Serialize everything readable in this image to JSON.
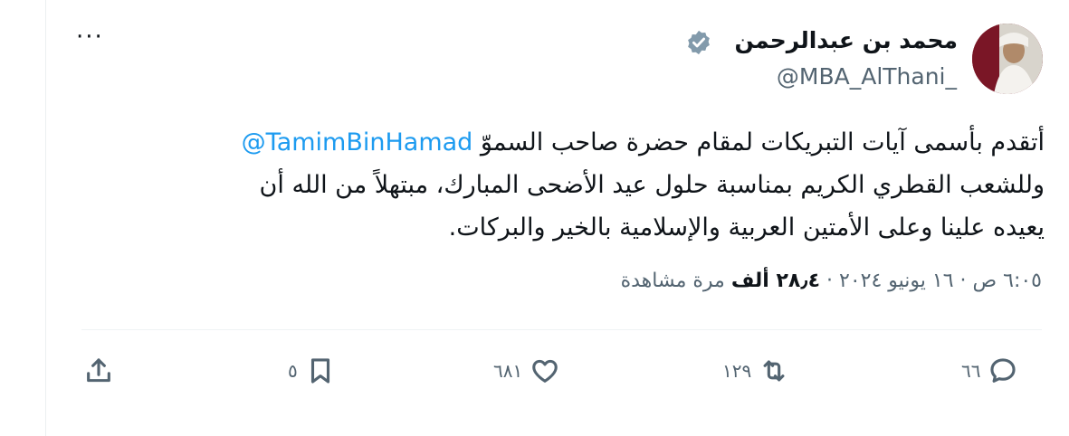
{
  "author": {
    "display_name": "محمد بن عبدالرحمن",
    "handle": "@MBA_AlThani_",
    "verified": true
  },
  "tweet": {
    "line1_prefix": "أتقدم بأسمى آيات التبريكات لمقام حضرة صاحب السموّ ",
    "mention": "@TamimBinHamad",
    "line2": "وللشعب القطري الكريم بمناسبة حلول عيد الأضحى المبارك، مبتهلاً من الله أن",
    "line3": "يعيده علينا وعلى الأمتين العربية والإسلامية بالخير والبركات."
  },
  "meta": {
    "time": "٦:٠٥ ص",
    "date": "١٦ يونيو ٢٠٢٤",
    "separator": "·",
    "views_count": "٢٨٫٤ ألف",
    "views_label": "مرة مشاهدة"
  },
  "actions": {
    "replies": "٦٦",
    "reposts": "١٢٩",
    "likes": "٦٨١",
    "bookmarks": "٥"
  },
  "icons": {
    "more": "more-icon",
    "reply": "reply-icon",
    "repost": "repost-icon",
    "like": "heart-icon",
    "bookmark": "bookmark-icon",
    "share": "share-icon",
    "verified": "verified-badge-icon"
  },
  "colors": {
    "link": "#1d9bf0",
    "secondary_text": "#536471",
    "primary_text": "#0f1419"
  }
}
